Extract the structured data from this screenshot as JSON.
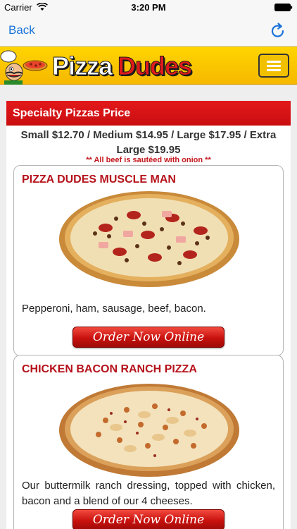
{
  "status_bar": {
    "carrier": "Carrier",
    "time": "3:20 PM"
  },
  "nav": {
    "back_label": "Back"
  },
  "site": {
    "logo_word1": "Pizza",
    "logo_word2": "Dudes",
    "brand_yellow": "#f6b800",
    "brand_red": "#e01b1b"
  },
  "menu": {
    "section_title": "Specialty Pizzas Price",
    "prices": "Small $12.70 / Medium $14.95 / Large $17.95 / Extra Large $19.95",
    "note": "** All beef is sautéed with onion **"
  },
  "pizzas": [
    {
      "name": "PIZZA DUDES MUSCLE MAN",
      "description": "Pepperoni, ham, sausage, beef, bacon.",
      "order_label": "Order Now Online"
    },
    {
      "name": "CHICKEN BACON RANCH PIZZA",
      "description": "Our buttermilk ranch dressing, topped with chicken, bacon and a blend of our 4 cheeses.",
      "order_label": "Order Now Online"
    }
  ]
}
